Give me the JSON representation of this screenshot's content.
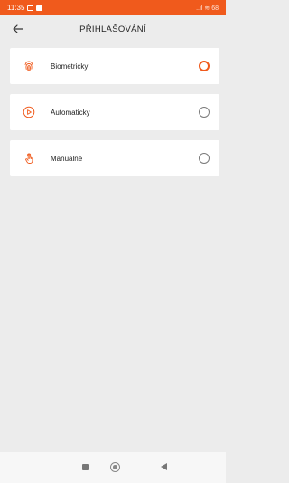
{
  "status_bar": {
    "time": "11:35",
    "right_text": "..ıl ≋ 68"
  },
  "header": {
    "back_icon": "arrow-left-icon",
    "title": "PŘIHLAŠOVÁNÍ"
  },
  "options": [
    {
      "label": "Biometricky",
      "icon": "fingerprint-icon",
      "selected": true
    },
    {
      "label": "Automaticky",
      "icon": "play-circle-icon",
      "selected": false
    },
    {
      "label": "Manuálně",
      "icon": "hand-tap-icon",
      "selected": false
    }
  ],
  "colors": {
    "accent": "#f05a1c",
    "background": "#ececec"
  }
}
